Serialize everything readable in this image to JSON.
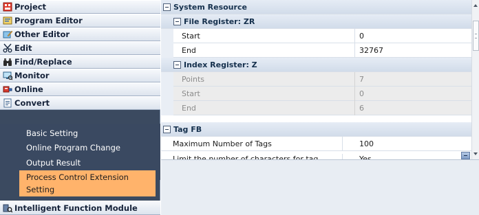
{
  "sidebar": {
    "categories": [
      {
        "label": "Project",
        "icon": "project-icon"
      },
      {
        "label": "Program Editor",
        "icon": "program-editor-icon"
      },
      {
        "label": "Other Editor",
        "icon": "other-editor-icon"
      },
      {
        "label": "Edit",
        "icon": "scissors-icon"
      },
      {
        "label": "Find/Replace",
        "icon": "binoculars-icon"
      },
      {
        "label": "Monitor",
        "icon": "monitor-icon"
      },
      {
        "label": "Online",
        "icon": "online-icon"
      },
      {
        "label": "Convert",
        "icon": "convert-icon"
      }
    ],
    "sub_items": [
      {
        "label": "Basic Setting"
      },
      {
        "label": "Online Program Change"
      },
      {
        "label": "Output Result"
      },
      {
        "line1": "Process Control Extension",
        "line2": "Setting",
        "selected": true
      }
    ],
    "bottom_category": {
      "label": "Intelligent Function Module",
      "icon": "intelligent-module-icon"
    }
  },
  "grid": {
    "system_resource": {
      "label": "System Resource"
    },
    "file_register": {
      "label": "File Register: ZR",
      "rows": [
        {
          "name": "Start",
          "value": "0"
        },
        {
          "name": "End",
          "value": "32767"
        }
      ]
    },
    "index_register": {
      "label": "Index Register: Z",
      "rows": [
        {
          "name": "Points",
          "value": "7"
        },
        {
          "name": "Start",
          "value": "0"
        },
        {
          "name": "End",
          "value": "6"
        }
      ]
    },
    "tag_fb": {
      "label": "Tag FB",
      "rows": [
        {
          "name": "Maximum Number of Tags",
          "value": "100"
        },
        {
          "name": "Limit the number of characters for tag name a",
          "value": "Yes"
        }
      ]
    }
  },
  "colors": {
    "sidebar_bg": "#3b4a60",
    "selected_item": "#ffb36b",
    "section_header": "#d8e1ee",
    "disabled_row": "#ececec",
    "description_panel": "#e8edf3"
  }
}
